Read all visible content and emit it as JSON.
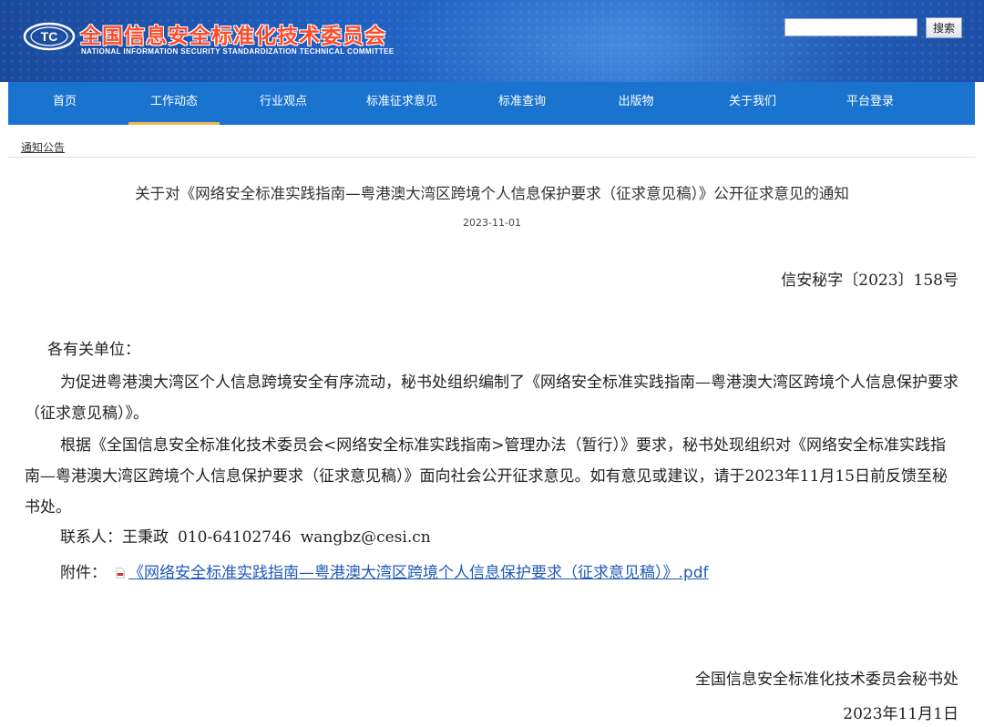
{
  "header": {
    "org_title": "全国信息安全标准化技术委员会",
    "org_subtitle": "NATIONAL INFORMATION SECURITY STANDARDIZATION TECHNICAL COMMITTEE",
    "search_value": "",
    "search_button": "搜索",
    "brand_color": "#1a73cf",
    "title_color": "#ff4b2a",
    "active_indicator_color": "#f2b84a"
  },
  "nav": {
    "items": [
      {
        "label": "首页"
      },
      {
        "label": "工作动态"
      },
      {
        "label": "行业观点"
      },
      {
        "label": "标准征求意见"
      },
      {
        "label": "标准查询"
      },
      {
        "label": "出版物"
      },
      {
        "label": "关于我们"
      },
      {
        "label": "平台登录"
      }
    ],
    "active": "工作动态"
  },
  "breadcrumb": {
    "label": "通知公告"
  },
  "article": {
    "title": "关于对《网络安全标准实践指南—粤港澳大湾区跨境个人信息保护要求（征求意见稿）》公开征求意见的通知",
    "date": "2023-11-01",
    "doc_number": "信安秘字〔2023〕158号",
    "salutation": "各有关单位：",
    "paragraph1": "为促进粤港澳大湾区个人信息跨境安全有序流动，秘书处组织编制了《网络安全标准实践指南—粤港澳大湾区跨境个人信息保护要求（征求意见稿）》。",
    "paragraph2": "根据《全国信息安全标准化技术委员会<网络安全标准实践指南>管理办法（暂行）》要求，秘书处现组织对《网络安全标准实践指南—粤港澳大湾区跨境个人信息保护要求（征求意见稿）》面向社会公开征求意见。如有意见或建议，请于2023年11月15日前反馈至秘书处。",
    "contact_label": "联系人：",
    "contact_name": "王秉政",
    "contact_phone": "010-64102746",
    "contact_email": "wangbz@cesi.cn",
    "attachment_label": "附件：",
    "attachment_link": "《网络安全标准实践指南—粤港澳大湾区跨境个人信息保护要求（征求意见稿）》.pdf",
    "signer": "全国信息安全标准化技术委员会秘书处",
    "sign_date": "2023年11月1日"
  }
}
